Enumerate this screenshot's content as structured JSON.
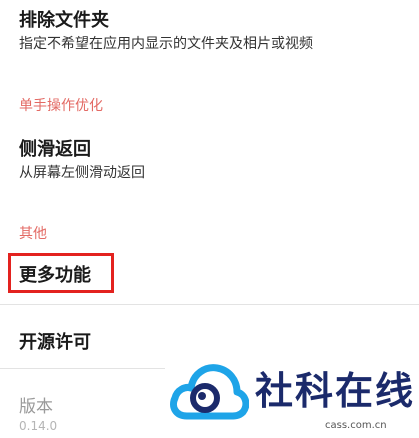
{
  "items": {
    "exclude_folder": {
      "title": "排除文件夹",
      "subtitle": "指定不希望在应用内显示的文件夹及相片或视频"
    },
    "section_one_hand": "单手操作优化",
    "swipe_back": {
      "title": "侧滑返回",
      "subtitle": "从屏幕左侧滑动返回"
    },
    "section_other": "其他",
    "more_features": {
      "title": "更多功能"
    },
    "open_source": {
      "title": "开源许可"
    },
    "version": {
      "title": "版本",
      "value": "0.14.0"
    }
  },
  "watermark": {
    "brand": "社科在线",
    "domain": "cass.com.cn"
  },
  "colors": {
    "section": "#e36a64",
    "highlight": "#e3221f",
    "brand": "#1b2a6b",
    "brand_icon": "#1ea4e8"
  }
}
